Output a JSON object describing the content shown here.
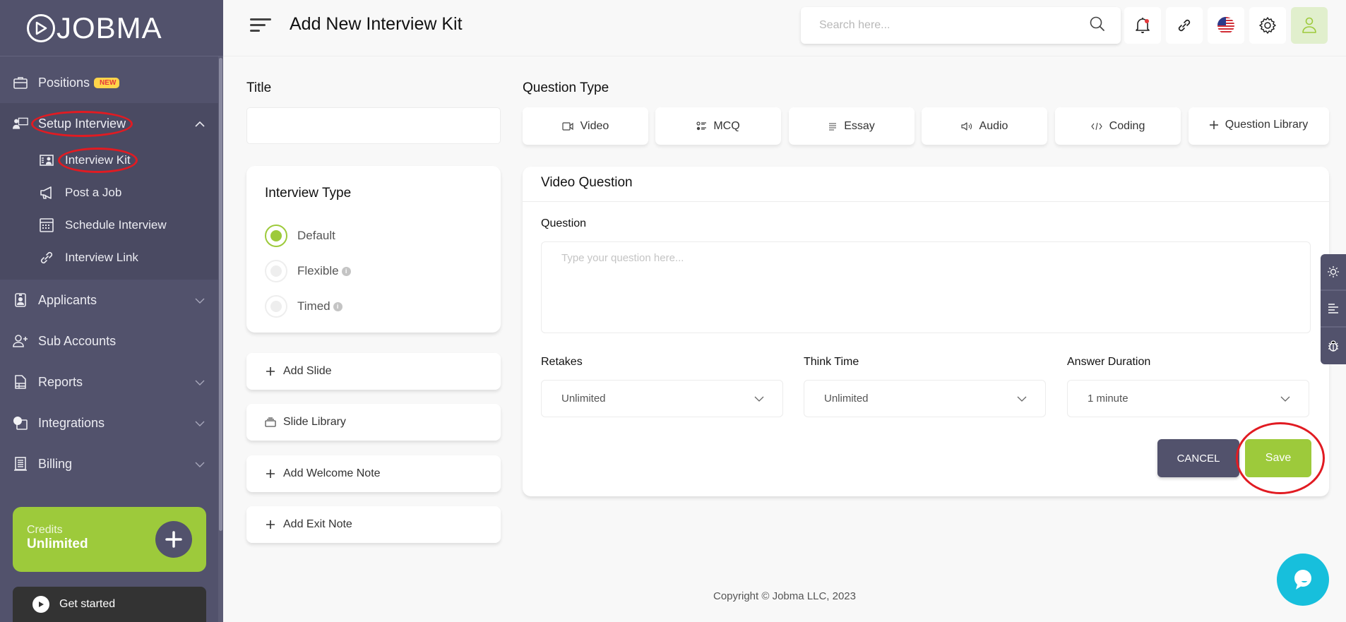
{
  "brand": {
    "name": "JOBMA",
    "accent": "#9dca3b",
    "sidebar_bg": "#52526c"
  },
  "sidebar": {
    "items": [
      {
        "label": "Positions",
        "icon": "briefcase-icon",
        "badge": "NEW"
      },
      {
        "label": "Setup Interview",
        "icon": "presenter-icon",
        "expanded": true,
        "children": [
          {
            "label": "Interview Kit",
            "icon": "id-card-icon",
            "active": true
          },
          {
            "label": "Post a Job",
            "icon": "megaphone-icon"
          },
          {
            "label": "Schedule Interview",
            "icon": "calendar-icon"
          },
          {
            "label": "Interview Link",
            "icon": "link-icon"
          }
        ]
      },
      {
        "label": "Applicants",
        "icon": "badge-icon"
      },
      {
        "label": "Sub Accounts",
        "icon": "user-plus-icon"
      },
      {
        "label": "Reports",
        "icon": "report-icon"
      },
      {
        "label": "Integrations",
        "icon": "integrations-icon"
      },
      {
        "label": "Billing",
        "icon": "billing-icon"
      }
    ],
    "credits": {
      "label": "Credits",
      "value": "Unlimited"
    },
    "get_started": "Get started"
  },
  "header": {
    "title": "Add New Interview Kit",
    "search_placeholder": "Search here..."
  },
  "form": {
    "title_label": "Title",
    "title_value": "",
    "interview_type": {
      "heading": "Interview Type",
      "options": [
        {
          "label": "Default",
          "selected": true
        },
        {
          "label": "Flexible",
          "selected": false,
          "info": true
        },
        {
          "label": "Timed",
          "selected": false,
          "info": true
        }
      ]
    },
    "actions": [
      {
        "label": "Add Slide",
        "icon": "plus-icon"
      },
      {
        "label": "Slide Library",
        "icon": "library-icon"
      },
      {
        "label": "Add Welcome Note",
        "icon": "plus-icon"
      },
      {
        "label": "Add Exit Note",
        "icon": "plus-icon"
      }
    ],
    "question_type": {
      "label": "Question Type",
      "options": [
        {
          "label": "Video",
          "icon": "video-icon"
        },
        {
          "label": "MCQ",
          "icon": "list-icon"
        },
        {
          "label": "Essay",
          "icon": "text-icon"
        },
        {
          "label": "Audio",
          "icon": "speaker-icon"
        },
        {
          "label": "Coding",
          "icon": "code-icon"
        },
        {
          "label": "Question Library",
          "icon": "plus-icon"
        }
      ]
    },
    "video_question": {
      "heading": "Video Question",
      "question_label": "Question",
      "question_placeholder": "Type your question here...",
      "retakes": {
        "label": "Retakes",
        "value": "Unlimited"
      },
      "think_time": {
        "label": "Think Time",
        "value": "Unlimited"
      },
      "answer_duration": {
        "label": "Answer Duration",
        "value": "1 minute"
      },
      "cancel": "CANCEL",
      "save": "Save"
    }
  },
  "footer": {
    "copyright": "Copyright © Jobma LLC, 2023"
  }
}
